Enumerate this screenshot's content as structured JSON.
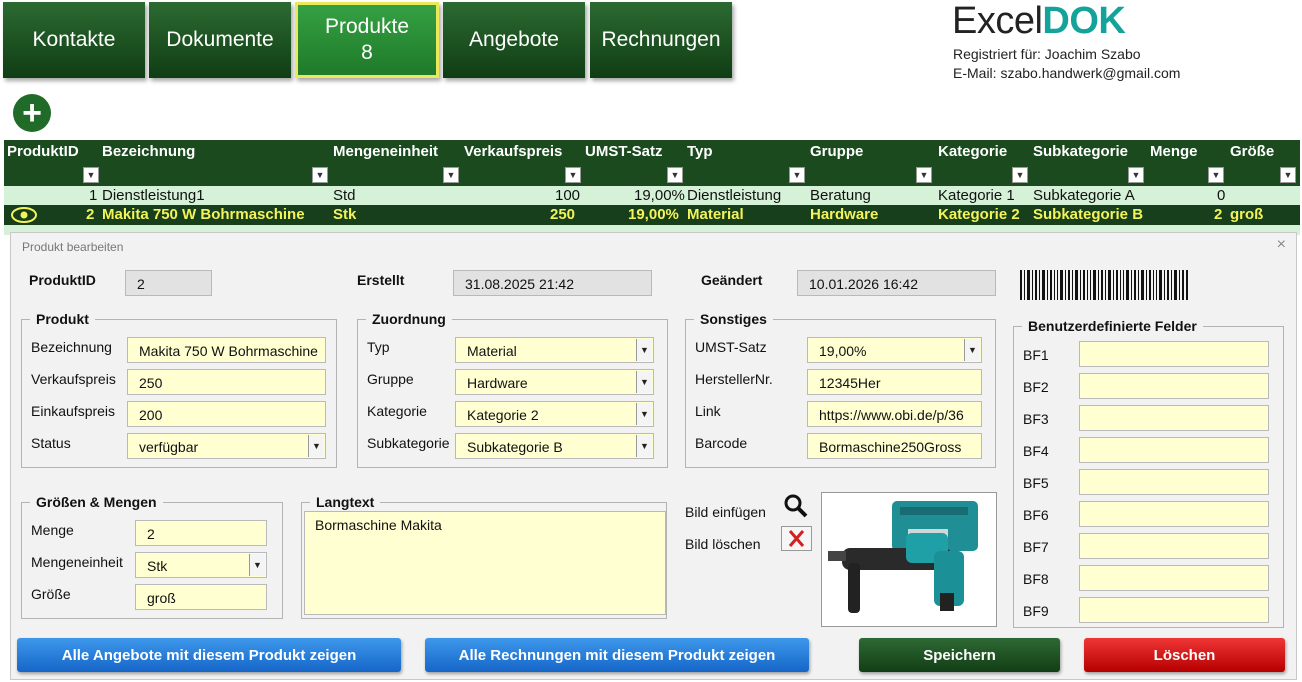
{
  "nav": [
    {
      "label": "Kontakte",
      "count": ""
    },
    {
      "label": "Dokumente",
      "count": ""
    },
    {
      "label": "Produkte",
      "count": "8"
    },
    {
      "label": "Angebote",
      "count": ""
    },
    {
      "label": "Rechnungen",
      "count": ""
    }
  ],
  "brand": {
    "logo_part1": "Excel",
    "logo_part2": "DOK",
    "registered": "Registriert für: Joachim Szabo",
    "email": "E-Mail: szabo.handwerk@gmail.com"
  },
  "table": {
    "headers": [
      "ProduktID",
      "Bezeichnung",
      "Mengeneinheit",
      "Verkaufspreis",
      "UMST-Satz",
      "Typ",
      "Gruppe",
      "Kategorie",
      "Subkategorie",
      "Menge",
      "Größe"
    ],
    "rows": [
      {
        "id": "1",
        "name": "Dienstleistung1",
        "unit": "Std",
        "price": "100",
        "tax": "19,00%",
        "type": "Dienstleistung",
        "group": "Beratung",
        "cat": "Kategorie 1",
        "subcat": "Subkategorie A",
        "qty": "0",
        "size": ""
      },
      {
        "id": "2",
        "name": "Makita 750 W Bohrmaschine",
        "unit": "Stk",
        "price": "250",
        "tax": "19,00%",
        "type": "Material",
        "group": "Hardware",
        "cat": "Kategorie 2",
        "subcat": "Subkategorie B",
        "qty": "2",
        "size": "groß"
      }
    ]
  },
  "dialog": {
    "title": "Produkt  bearbeiten",
    "close": "×",
    "produktid_label": "ProduktID",
    "produktid": "2",
    "erstellt_label": "Erstellt",
    "erstellt": "31.08.2025 21:42",
    "geaendert_label": "Geändert",
    "geaendert": "10.01.2026 16:42",
    "produkt": {
      "title": "Produkt",
      "bezeichnung_label": "Bezeichnung",
      "bezeichnung": "Makita 750 W Bohrmaschine",
      "vk_label": "Verkaufspreis",
      "vk": "250",
      "ek_label": "Einkaufspreis",
      "ek": "200",
      "status_label": "Status",
      "status": "verfügbar"
    },
    "zuordnung": {
      "title": "Zuordnung",
      "typ_label": "Typ",
      "typ": "Material",
      "gruppe_label": "Gruppe",
      "gruppe": "Hardware",
      "kategorie_label": "Kategorie",
      "kategorie": "Kategorie 2",
      "subkategorie_label": "Subkategorie",
      "subkategorie": "Subkategorie B"
    },
    "sonstiges": {
      "title": "Sonstiges",
      "umst_label": "UMST-Satz",
      "umst": "19,00%",
      "herst_label": "HerstellerNr.",
      "herst": "12345Her",
      "link_label": "Link",
      "link": "https://www.obi.de/p/36",
      "barcode_label": "Barcode",
      "barcode": "Bormaschine250Gross"
    },
    "custom": {
      "title": "Benutzerdefinierte Felder",
      "labels": [
        "BF1",
        "BF2",
        "BF3",
        "BF4",
        "BF5",
        "BF6",
        "BF7",
        "BF8",
        "BF9"
      ]
    },
    "mengen": {
      "title": "Größen & Mengen",
      "menge_label": "Menge",
      "menge": "2",
      "einheit_label": "Mengeneinheit",
      "einheit": "Stk",
      "groesse_label": "Größe",
      "groesse": "groß"
    },
    "langtext": {
      "title": "Langtext",
      "text": "Bormaschine Makita"
    },
    "bild_einfuegen": "Bild einfügen",
    "bild_loeschen": "Bild löschen",
    "buttons": {
      "angebote": "Alle Angebote mit diesem Produkt zeigen",
      "rechnungen": "Alle Rechnungen mit diesem Produkt zeigen",
      "speichern": "Speichern",
      "loeschen": "Löschen"
    }
  },
  "colors": {
    "nav_green": "#1f5a24",
    "header_green": "#1a4a1e",
    "highlight_yellow": "#f3f35a",
    "field_yellow": "#ffffd2",
    "brand_teal": "#14a39a"
  }
}
